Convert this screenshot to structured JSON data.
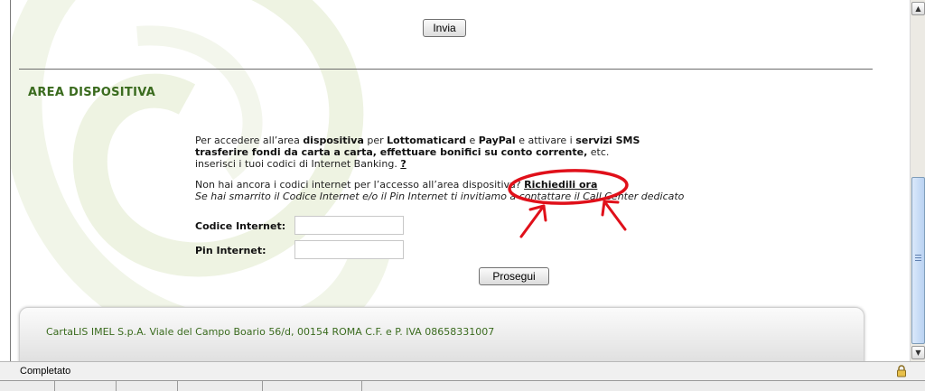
{
  "header": {
    "submit_label": "Invia"
  },
  "section": {
    "title": "AREA DISPOSITIVA",
    "intro_p1": "Per accedere all’area ",
    "intro_b1": "dispositiva",
    "intro_p2": " per ",
    "intro_b2": "Lottomaticard",
    "intro_p3": " e ",
    "intro_b3": "PayPal",
    "intro_p4": " e attivare i ",
    "intro_b4": "servizi SMS",
    "intro_b5": "trasferire fondi da carta a carta, effettuare bonifici su conto corrente,",
    "intro_p5": " etc.",
    "intro_line3": "inserisci i tuoi codici di Internet Banking. ",
    "help_link": "?",
    "no_codes_text": "Non hai ancora i codici internet per l’accesso all’area dispositiva? ",
    "request_link": "Richiedili ora",
    "lost_text": "Se hai smarrito il Codice Internet e/o il Pin Internet ti invitiamo a contattare il Call Center dedicato"
  },
  "form": {
    "codice_label": "Codice Internet:",
    "codice_value": "",
    "pin_label": "Pin Internet:",
    "pin_value": "",
    "continue_label": "Prosegui"
  },
  "footer": {
    "text": "CartaLIS IMEL S.p.A. Viale del Campo Boario 56/d, 00154 ROMA C.F. e P. IVA 08658331007"
  },
  "statusbar": {
    "text": "Completato"
  },
  "colors": {
    "title_green": "#3a6b1e",
    "annotation_red": "#e0101a",
    "thumb_blue": "#b9d2f2"
  },
  "icons": {
    "security": "lock-icon",
    "scroll_up": "arrow-up-icon",
    "scroll_down": "arrow-down-icon"
  }
}
